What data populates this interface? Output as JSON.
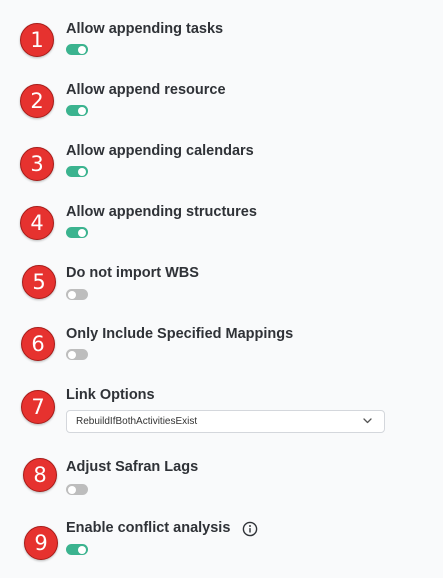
{
  "settings": [
    {
      "number": "1",
      "label": "Allow appending tasks",
      "enabled": true
    },
    {
      "number": "2",
      "label": "Allow append resource",
      "enabled": true
    },
    {
      "number": "3",
      "label": "Allow appending calendars",
      "enabled": true
    },
    {
      "number": "4",
      "label": "Allow appending structures",
      "enabled": true
    },
    {
      "number": "5",
      "label": "Do not import WBS",
      "enabled": false
    },
    {
      "number": "6",
      "label": "Only Include Specified Mappings",
      "enabled": false
    },
    {
      "number": "7",
      "label": "Link Options",
      "selected_value": "RebuildIfBothActivitiesExist"
    },
    {
      "number": "8",
      "label": "Adjust Safran Lags",
      "enabled": false
    },
    {
      "number": "9",
      "label": "Enable conflict analysis",
      "enabled": true
    }
  ],
  "icons": {
    "info": "info-icon",
    "dropdown": "chevron-down-icon"
  },
  "colors": {
    "background": "#f9fafb",
    "marker": "#e6322f",
    "toggle_on": "#3bb38f",
    "toggle_off": "#bdbdbd",
    "label_text": "#2f3237"
  }
}
